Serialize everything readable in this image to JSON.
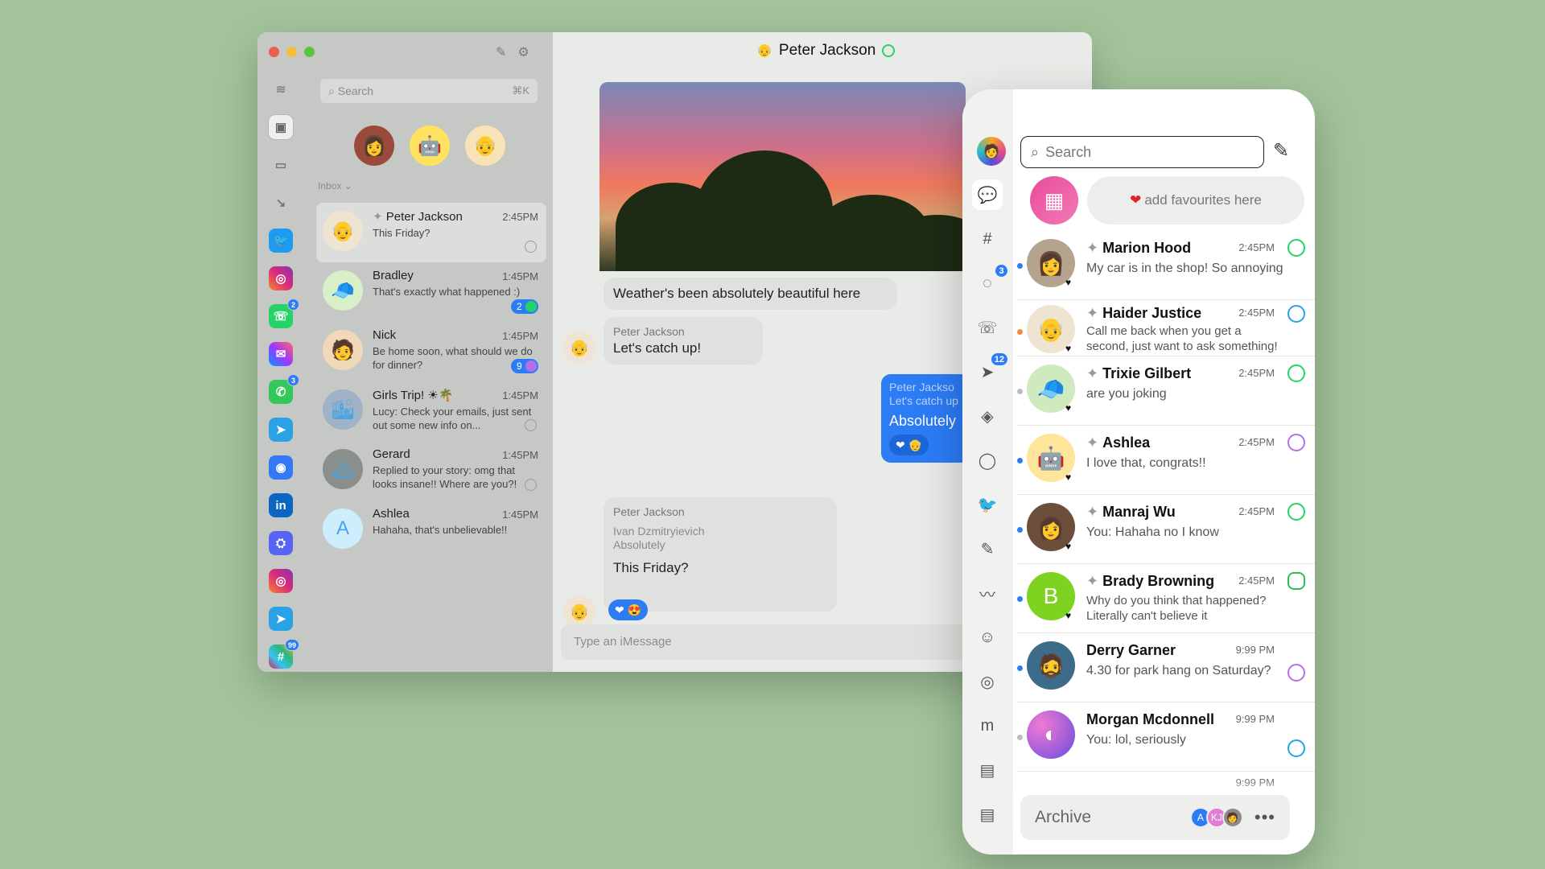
{
  "desktop": {
    "search_placeholder": "Search",
    "search_shortcut": "⌘K",
    "compose_icon": "✎",
    "settings_icon": "⚙",
    "inbox_label": "Inbox ⌄",
    "rail_badges": {
      "whatsapp": "2",
      "messages": "3",
      "slack": "99"
    },
    "rail_icons": [
      "≋",
      "▣",
      "▭",
      "↘",
      "🐦",
      "◎",
      "☏",
      "✉",
      "✆",
      "➤",
      "◉",
      "in",
      "⛭",
      "◎",
      "➤",
      "#"
    ],
    "favorites": [
      "👩",
      "🤖",
      "👴"
    ],
    "chats": [
      {
        "name": "Peter Jackson",
        "time": "2:45PM",
        "preview": "This Friday?",
        "avatar": "👴",
        "color": "#efe3d2"
      },
      {
        "name": "Bradley",
        "time": "1:45PM",
        "preview": "That's exactly what happened :)",
        "avatar": "🧢",
        "color": "#d8efc8",
        "count": "2"
      },
      {
        "name": "Nick",
        "time": "1:45PM",
        "preview": "Be home soon, what should we do for dinner?",
        "avatar": "🧑",
        "color": "#f1d8b8",
        "count": "9"
      },
      {
        "name": "Girls Trip! ☀🌴",
        "time": "1:45PM",
        "preview": "Lucy: Check your emails, just sent out some new info on...",
        "avatar": "🏙",
        "color": "#9fb2c7"
      },
      {
        "name": "Gerard",
        "time": "1:45PM",
        "preview": "Replied to your story: omg that looks insane!! Where are you?!",
        "avatar": "🏔",
        "color": "#8a8f8c"
      },
      {
        "name": "Ashlea",
        "time": "1:45PM",
        "preview": "Hahaha, that's unbelievable!!",
        "avatar": "A",
        "color": "#cfeefd"
      }
    ],
    "conversation": {
      "title": "Peter Jackson",
      "title_avatar": "👴",
      "weather": "Weather's been absolutely beautiful here",
      "catch_who": "Peter Jackson",
      "catch_text": "Let's catch up!",
      "out_quote_who": "Peter Jackso",
      "out_quote_text": "Let's catch up",
      "out_text": "Absolutely",
      "out_reactions": "❤ 👴",
      "friday_who": "Peter Jackson",
      "friday_quote_who": "Ivan Dzmitryievich",
      "friday_quote_text": "Absolutely",
      "friday_text": "This Friday?",
      "friday_reactions": "❤ 😍",
      "msg_avatar": "👴",
      "composer_placeholder": "Type an  iMessage"
    }
  },
  "phone": {
    "search_placeholder": "Search",
    "compose_icon": "✎",
    "fav_card_icon": "▦",
    "fav_pill_heart": "❤",
    "fav_pill_text": "add favourites here",
    "rail_icons": [
      "💬",
      "#",
      "◌",
      "☏",
      "➤",
      "◈",
      "◯",
      "🐦",
      "✎",
      "〰",
      "☺",
      "◎",
      "m",
      "▤",
      "▤"
    ],
    "rail_badges": {
      "stories": "3",
      "telegram": "12"
    },
    "chats": [
      {
        "name": "Marion Hood",
        "time": "2:45PM",
        "preview": "My car is in the shop! So annoying",
        "avatar": "👩",
        "color": "#b5a48d",
        "src": "wa"
      },
      {
        "name": "Haider Justice",
        "time": "2:45PM",
        "preview": "Call me back when you get a second, just want to ask something!",
        "avatar": "👴",
        "color": "#efe3d2",
        "src": "tg"
      },
      {
        "name": "Trixie Gilbert",
        "time": "2:45PM",
        "preview": "are you joking",
        "avatar": "🧢",
        "color": "#cfeabf",
        "src": "wa"
      },
      {
        "name": "Ashlea",
        "time": "2:45PM",
        "preview": "I love that, congrats!!",
        "avatar": "🤖",
        "color": "#ffe59a",
        "src": "ms"
      },
      {
        "name": "Manraj Wu",
        "time": "2:45PM",
        "preview": "You: Hahaha no I know",
        "avatar": "👩",
        "color": "#6b4f3a",
        "src": "wa"
      },
      {
        "name": "Brady Browning",
        "time": "2:45PM",
        "preview": "Why do you think that happened? Literally can't believe it",
        "avatar": "B",
        "color": "#7ed321",
        "src": "im"
      },
      {
        "name": "Derry Garner",
        "time": "9:99 PM",
        "preview": "4.30 for park hang on Saturday?",
        "avatar": "🧔",
        "color": "#3d6b8a",
        "src": "ms"
      },
      {
        "name": "Morgan Mcdonnell",
        "time": "9:99 PM",
        "preview": "You: lol, seriously",
        "avatar": "◐",
        "color": "#8c5fd6",
        "src": "tg"
      }
    ],
    "peek_time": "9:99 PM",
    "archive_label": "Archive",
    "archive_avatars": [
      "A",
      "KJ",
      "🧑"
    ],
    "archive_more": "•••"
  }
}
